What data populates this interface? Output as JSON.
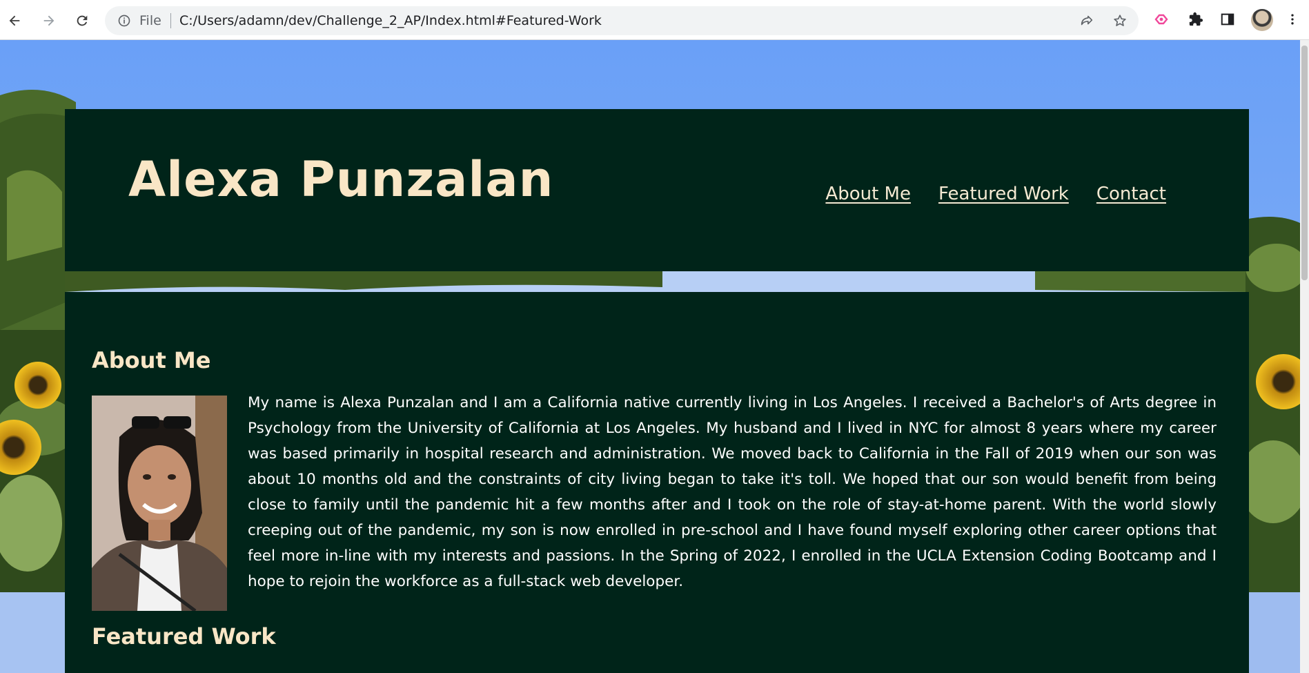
{
  "browser": {
    "address_scheme": "File",
    "url": "C:/Users/adamn/dev/Challenge_2_AP/Index.html#Featured-Work"
  },
  "site": {
    "title": "Alexa Punzalan",
    "nav": [
      {
        "label": "About Me"
      },
      {
        "label": "Featured Work"
      },
      {
        "label": "Contact"
      }
    ]
  },
  "about": {
    "heading": "About Me",
    "paragraph": "My name is Alexa Punzalan and I am a California native currently living in Los Angeles. I received a Bachelor's of Arts degree in Psychology from the University of California at Los Angeles. My husband and I lived in NYC for almost 8 years where my career was based primarily in hospital research and administration. We moved back to California in the Fall of 2019 when our son was about 10 months old and the constraints of city living began to take it's toll. We hoped that our son would benefit from being close to family until the pandemic hit a few months after and I took on the role of stay-at-home parent. With the world slowly creeping out of the pandemic, my son is now enrolled in pre-school and I have found myself exploring other career options that feel more in-line with my interests and passions. In the Spring of 2022, I enrolled in the UCLA Extension Coding Bootcamp and I hope to rejoin the workforce as a full-stack web developer."
  },
  "featured": {
    "heading": "Featured Work"
  },
  "colors": {
    "panel": "#002419",
    "title": "#f9e6c6",
    "sky": "#6fa3f7"
  },
  "icons": [
    "back-arrow-icon",
    "forward-arrow-icon",
    "reload-icon",
    "info-icon",
    "share-icon",
    "star-icon",
    "extension-pink-icon",
    "puzzle-icon",
    "sidepanel-icon",
    "more-vert-icon"
  ]
}
